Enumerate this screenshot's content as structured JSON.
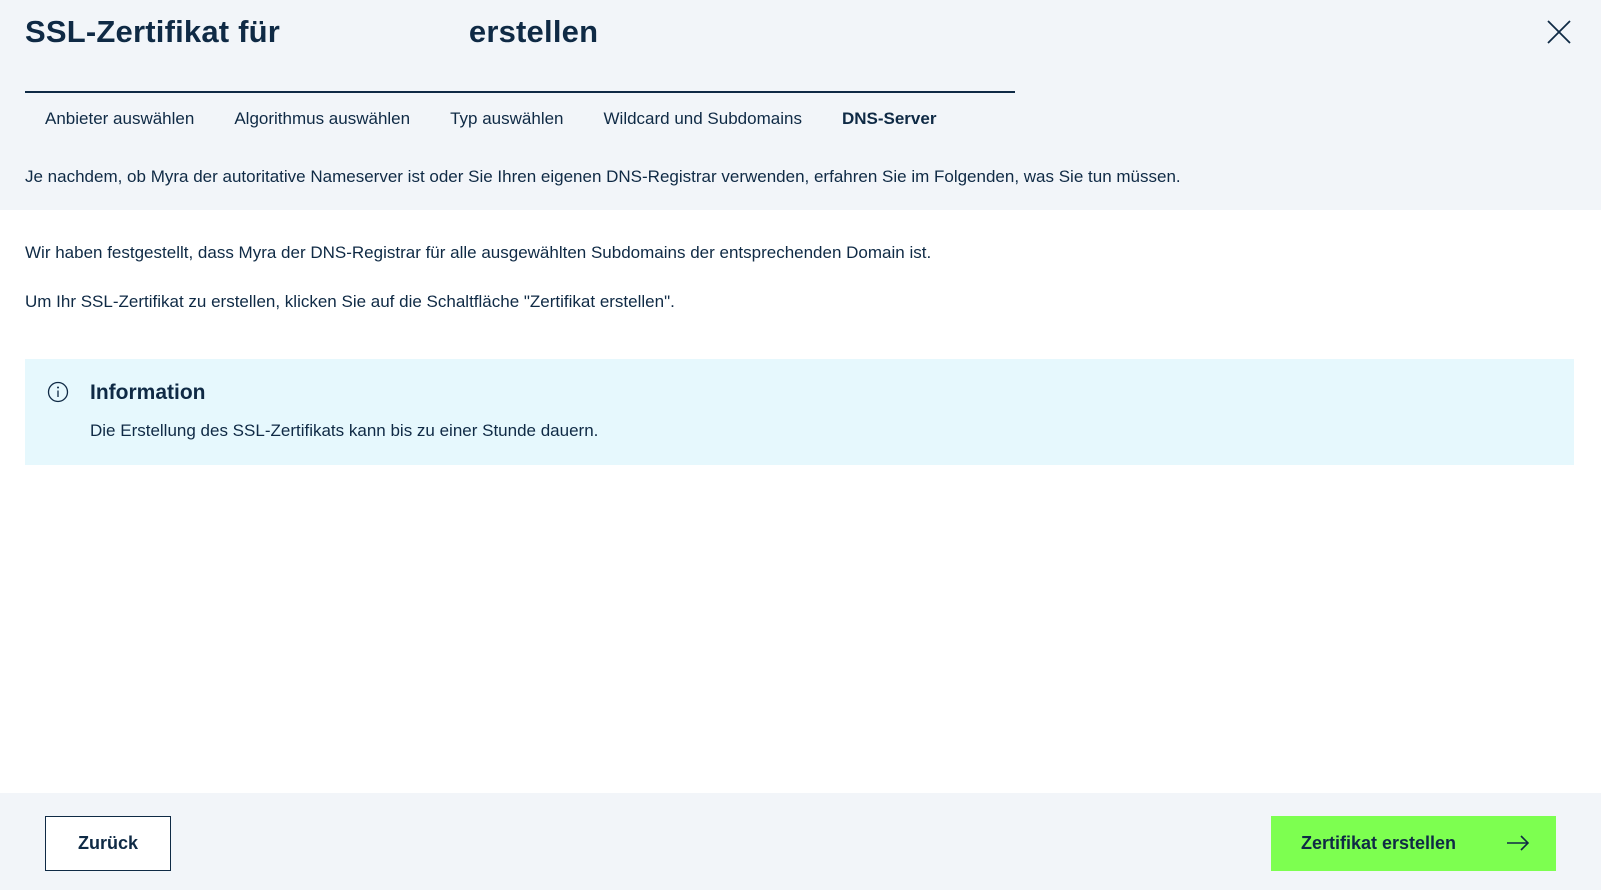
{
  "header": {
    "title_prefix": "SSL-Zertifikat für ",
    "title_suffix": "erstellen",
    "close_icon": "close-icon",
    "description": "Je nachdem, ob Myra der autoritative Nameserver ist oder Sie Ihren eigenen DNS-Registrar verwenden, erfahren Sie im Folgenden, was Sie tun müssen."
  },
  "steps": [
    {
      "label": "Anbieter auswählen",
      "active": false
    },
    {
      "label": "Algorithmus auswählen",
      "active": false
    },
    {
      "label": "Typ auswählen",
      "active": false
    },
    {
      "label": "Wildcard und Subdomains",
      "active": false
    },
    {
      "label": "DNS-Server",
      "active": true
    }
  ],
  "body": {
    "paragraph1": "Wir haben festgestellt, dass Myra der DNS-Registrar für alle ausgewählten Subdomains der entsprechenden Domain ist.",
    "paragraph2": "Um Ihr SSL-Zertifikat zu erstellen, klicken Sie auf die Schaltfläche \"Zertifikat erstellen\"."
  },
  "info": {
    "icon": "info-icon",
    "title": "Information",
    "text": "Die Erstellung des SSL-Zertifikats kann bis zu einer Stunde dauern."
  },
  "footer": {
    "back_label": "Zurück",
    "create_label": "Zertifikat erstellen",
    "create_icon": "arrow-right-icon"
  },
  "colors": {
    "primary_text": "#0f2a45",
    "header_bg": "#f2f5f9",
    "info_bg": "#e6f8fd",
    "accent_green": "#7dff50"
  }
}
